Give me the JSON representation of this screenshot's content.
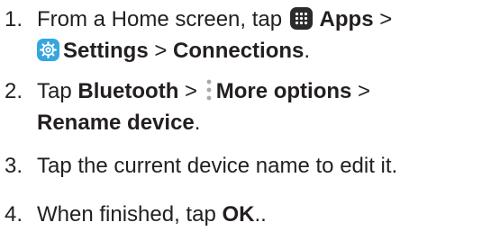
{
  "steps": [
    {
      "number": "1.",
      "line1": {
        "t1": "From a Home screen, tap ",
        "apps_icon": "apps-grid-icon",
        "apps": " Apps",
        "sep": " >"
      },
      "line2": {
        "settings_icon": "settings-gear-icon",
        "settings": "Settings",
        "sep": " > ",
        "connections": "Connections",
        "end": "."
      }
    },
    {
      "number": "2.",
      "line1": {
        "t1": "Tap ",
        "bluetooth": "Bluetooth",
        "sep1": " > ",
        "more_icon": "more-options-icon",
        "more": "More options",
        "sep2": " >"
      },
      "line2": {
        "rename": "Rename device",
        "end": "."
      }
    },
    {
      "number": "3.",
      "text": "Tap the current device name to edit it."
    },
    {
      "number": "4.",
      "t1": "When finished, tap ",
      "ok": "OK",
      "end": ".."
    }
  ],
  "colors": {
    "text": "#231f20",
    "apps_icon_bg": "#2b2b2b",
    "settings_icon_bg": "#35a6df"
  }
}
